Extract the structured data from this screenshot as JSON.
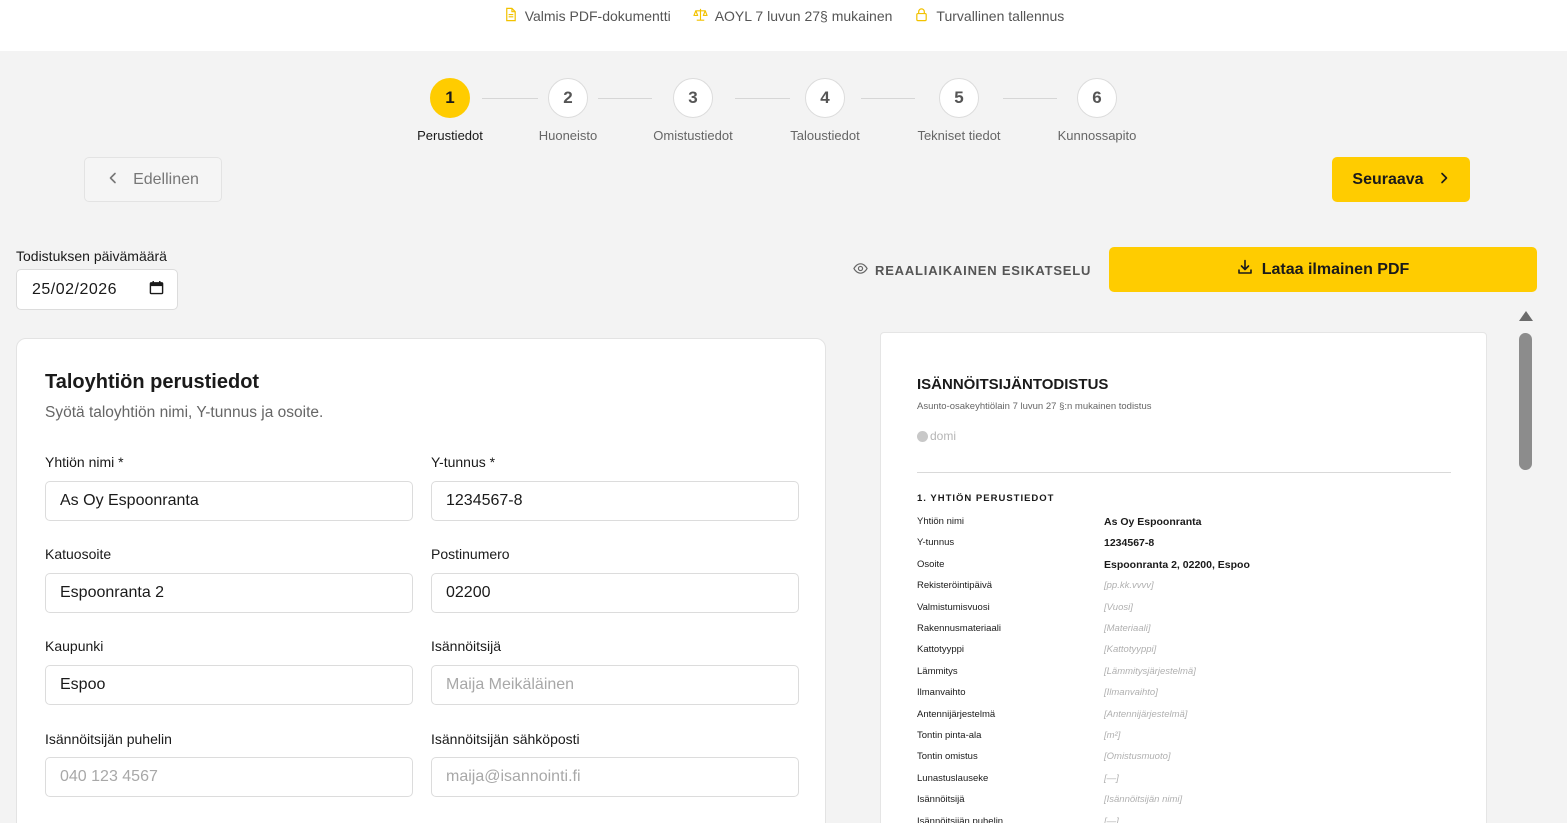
{
  "badges": [
    {
      "icon": "document-icon",
      "label": "Valmis PDF-dokumentti"
    },
    {
      "icon": "scales-icon",
      "label": "AOYL 7 luvun 27§ mukainen"
    },
    {
      "icon": "lock-icon",
      "label": "Turvallinen tallennus"
    }
  ],
  "steps": [
    {
      "number": "1",
      "label": "Perustiedot"
    },
    {
      "number": "2",
      "label": "Huoneisto"
    },
    {
      "number": "3",
      "label": "Omistustiedot"
    },
    {
      "number": "4",
      "label": "Taloustiedot"
    },
    {
      "number": "5",
      "label": "Tekniset tiedot"
    },
    {
      "number": "6",
      "label": "Kunnossapito"
    }
  ],
  "current_step": 1,
  "nav": {
    "prev_label": "Edellinen",
    "next_label": "Seuraava"
  },
  "date": {
    "label": "Todistuksen päivämäärä",
    "value": "25/02/2026"
  },
  "preview": {
    "label": "REAALIAIKAINEN ESIKATSELU",
    "download_label": "Lataa ilmainen PDF"
  },
  "form": {
    "title": "Taloyhtiön perustiedot",
    "subtitle": "Syötä taloyhtiön nimi, Y-tunnus ja osoite.",
    "fields": {
      "company_name": {
        "label": "Yhtiön nimi *",
        "value": "As Oy Espoonranta",
        "placeholder": ""
      },
      "business_id": {
        "label": "Y-tunnus *",
        "value": "1234567-8",
        "placeholder": ""
      },
      "street": {
        "label": "Katuosoite",
        "value": "Espoonranta 2",
        "placeholder": ""
      },
      "postal_code": {
        "label": "Postinumero",
        "value": "02200",
        "placeholder": ""
      },
      "city": {
        "label": "Kaupunki",
        "value": "Espoo",
        "placeholder": ""
      },
      "manager": {
        "label": "Isännöitsijä",
        "value": "",
        "placeholder": "Maija Meikäläinen"
      },
      "manager_phone": {
        "label": "Isännöitsijän puhelin",
        "value": "",
        "placeholder": "040 123 4567"
      },
      "manager_email": {
        "label": "Isännöitsijän sähköposti",
        "value": "",
        "placeholder": "maija@isannointi.fi"
      }
    }
  },
  "document": {
    "title": "ISÄNNÖITSIJÄNTODISTUS",
    "subtitle": "Asunto-osakeyhtiölain 7 luvun 27 §:n mukainen todistus",
    "logo_text": "domi",
    "section_title": "1. YHTIÖN PERUSTIEDOT",
    "rows": [
      {
        "key": "Yhtiön nimi",
        "value": "As Oy Espoonranta",
        "filled": true
      },
      {
        "key": "Y-tunnus",
        "value": "1234567-8",
        "filled": true
      },
      {
        "key": "Osoite",
        "value": "Espoonranta 2, 02200, Espoo",
        "filled": true
      },
      {
        "key": "Rekisteröintipäivä",
        "value": "[pp.kk.vvvv]",
        "filled": false
      },
      {
        "key": "Valmistumisvuosi",
        "value": "[Vuosi]",
        "filled": false
      },
      {
        "key": "Rakennusmateriaali",
        "value": "[Materiaali]",
        "filled": false
      },
      {
        "key": "Kattotyyppi",
        "value": "[Kattotyyppi]",
        "filled": false
      },
      {
        "key": "Lämmitys",
        "value": "[Lämmitysjärjestelmä]",
        "filled": false
      },
      {
        "key": "Ilmanvaihto",
        "value": "[Ilmanvaihto]",
        "filled": false
      },
      {
        "key": "Antennijärjestelmä",
        "value": "[Antennijärjestelmä]",
        "filled": false
      },
      {
        "key": "Tontin pinta-ala",
        "value": "[m²]",
        "filled": false
      },
      {
        "key": "Tontin omistus",
        "value": "[Omistusmuoto]",
        "filled": false
      },
      {
        "key": "Lunastuslauseke",
        "value": "[—]",
        "filled": false
      },
      {
        "key": "Isännöitsijä",
        "value": "[Isännöitsijän nimi]",
        "filled": false
      },
      {
        "key": "Isännöitsijän puhelin",
        "value": "[—]",
        "filled": false
      }
    ]
  },
  "colors": {
    "accent": "#ffcc00",
    "background": "#f3f3f3",
    "surface": "#ffffff",
    "border": "#dcdcdc"
  }
}
